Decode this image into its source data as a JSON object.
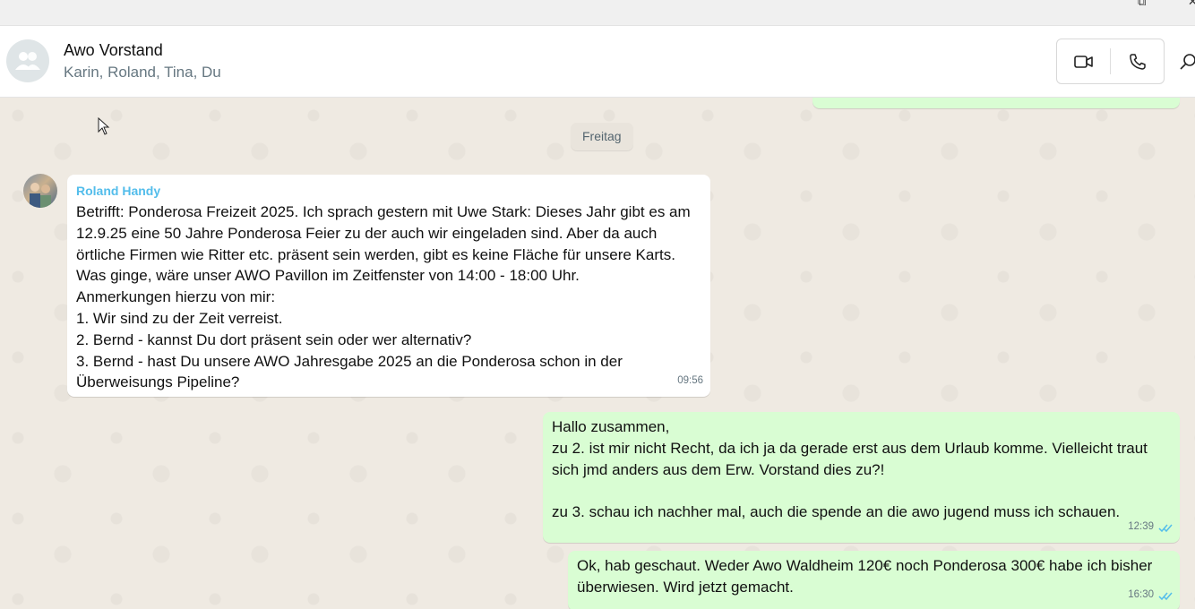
{
  "window": {
    "controls": [
      "⧉",
      "✕"
    ]
  },
  "header": {
    "title": "Awo Vorstand",
    "members": "Karin, Roland, Tina, Du"
  },
  "chat": {
    "date_divider": "Freitag",
    "messages": [
      {
        "direction": "incoming",
        "sender": "Roland Handy",
        "lines": [
          "Betrifft: Ponderosa Freizeit 2025. Ich sprach gestern mit Uwe Stark: Dieses Jahr gibt es am",
          "12.9.25 eine 50 Jahre Ponderosa Feier zu der auch wir eingeladen sind. Aber da auch",
          "örtliche Firmen wie Ritter etc. präsent sein werden, gibt es keine Fläche für unsere Karts.",
          "Was ginge, wäre unser AWO Pavillon im Zeitfenster von 14:00 - 18:00 Uhr.",
          "Anmerkungen hierzu von mir:",
          "1. Wir sind zu der Zeit verreist.",
          "2. Bernd - kannst Du dort präsent sein oder wer alternativ?",
          "3. Bernd - hast Du unsere AWO Jahresgabe 2025 an die Ponderosa schon in der",
          "Überweisungs Pipeline?"
        ],
        "time": "09:56"
      },
      {
        "direction": "outgoing",
        "lines": [
          "Hallo zusammen,",
          "zu 2. ist mir nicht Recht, da ich ja da gerade erst aus dem Urlaub komme. Vielleicht traut",
          "sich jmd anders aus dem Erw. Vorstand dies zu?!",
          "",
          "zu 3. schau ich nachher mal, auch die spende an die awo jugend muss ich schauen."
        ],
        "time": "12:39",
        "status": "read"
      },
      {
        "direction": "outgoing",
        "lines": [
          "Ok, hab geschaut. Weder Awo Waldheim 120€ noch Ponderosa 300€ habe ich bisher",
          "überwiesen. Wird jetzt gemacht."
        ],
        "time": "16:30",
        "status": "read"
      }
    ]
  },
  "colors": {
    "outgoing_bubble": "#d9fdd3",
    "incoming_bubble": "#ffffff",
    "sender_name": "#53bdeb",
    "read_ticks": "#53bdeb",
    "chat_background": "#efeae2"
  },
  "icons": {
    "video_call": "video-camera-icon",
    "voice_call": "phone-icon",
    "search": "search-icon",
    "group_avatar": "group-avatar-icon"
  }
}
